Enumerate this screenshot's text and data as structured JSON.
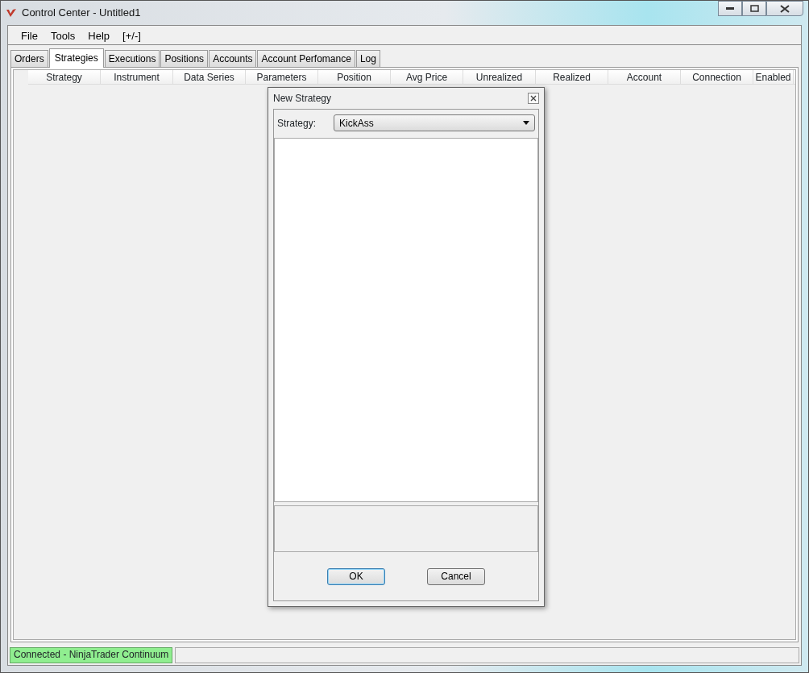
{
  "window": {
    "title": "Control Center - Untitled1"
  },
  "menu": [
    "File",
    "Tools",
    "Help",
    "[+/-]"
  ],
  "tabs": [
    {
      "label": "Orders",
      "selected": false
    },
    {
      "label": "Strategies",
      "selected": true
    },
    {
      "label": "Executions",
      "selected": false
    },
    {
      "label": "Positions",
      "selected": false
    },
    {
      "label": "Accounts",
      "selected": false
    },
    {
      "label": "Account Perfomance",
      "selected": false
    },
    {
      "label": "Log",
      "selected": false
    }
  ],
  "table": {
    "columns": [
      "Strategy",
      "Instrument",
      "Data Series",
      "Parameters",
      "Position",
      "Avg Price",
      "Unrealized",
      "Realized",
      "Account",
      "Connection",
      "Enabled"
    ]
  },
  "dialog": {
    "title": "New Strategy",
    "strategy_label": "Strategy:",
    "strategy_value": "KickAss",
    "buttons": [
      {
        "label": "OK",
        "default": true
      },
      {
        "label": "Cancel",
        "default": false
      }
    ]
  },
  "status_bar": {
    "text": "Connected - NinjaTrader Continuum",
    "connected": true
  }
}
